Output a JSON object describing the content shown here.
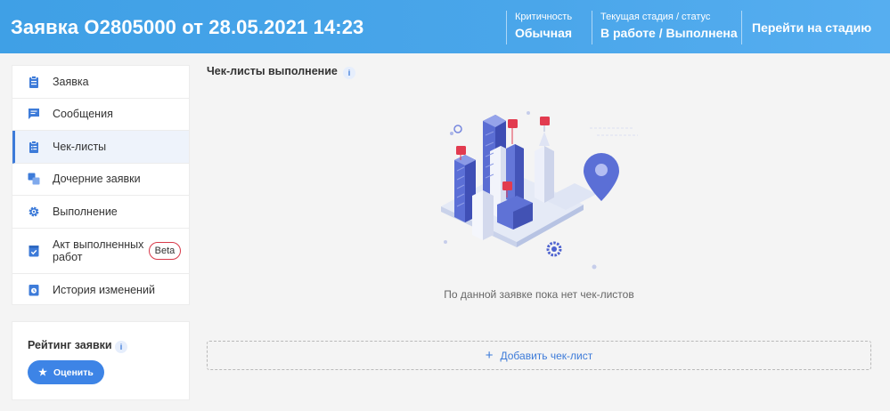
{
  "header": {
    "title": "Заявка О2805000 от 28.05.2021 14:23",
    "criticality_label": "Критичность",
    "criticality_value": "Обычная",
    "stage_label": "Текущая стадия / статус",
    "stage_value": "В работе / Выполнена",
    "goto_stage": "Перейти на стадию"
  },
  "sidebar": {
    "items": [
      {
        "label": "Заявка",
        "icon": "clipboard-icon"
      },
      {
        "label": "Сообщения",
        "icon": "chat-icon"
      },
      {
        "label": "Чек-листы",
        "icon": "checklist-icon",
        "active": true
      },
      {
        "label": "Дочерние заявки",
        "icon": "child-requests-icon"
      },
      {
        "label": "Выполнение",
        "icon": "gear-icon"
      },
      {
        "label": "Акт выполненных работ",
        "icon": "act-document-icon",
        "badge": "Beta"
      },
      {
        "label": "История изменений",
        "icon": "history-icon"
      }
    ]
  },
  "rating": {
    "title": "Рейтинг заявки",
    "info": "i",
    "button": "Оценить"
  },
  "main": {
    "title": "Чек-листы выполнение",
    "info": "i",
    "empty_text": "По данной заявке пока нет чек-листов",
    "add_button": "Добавить чек-лист",
    "add_icon": "+"
  },
  "colors": {
    "header_bg": "#4aa6ea",
    "accent": "#3d7bd9",
    "beta_border": "#d83a4a",
    "page_bg": "#f4f4f4"
  }
}
